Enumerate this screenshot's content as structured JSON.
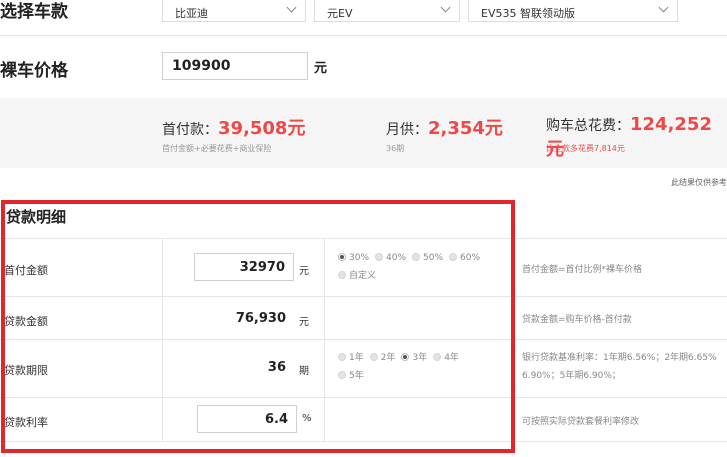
{
  "car_select": {
    "title": "选择车款",
    "brand": "比亚迪",
    "series": "元EV",
    "model": "EV535 智联领动版"
  },
  "price": {
    "title": "裸车价格",
    "value": "109900",
    "unit": "元"
  },
  "summary": {
    "down_label": "首付款：",
    "down_value": "39,508元",
    "down_sub": "首付金额+必要花费+商业保险",
    "monthly_label": "月供：",
    "monthly_value": "2,354元",
    "monthly_sub": "36期",
    "total_label": "购车总花费：",
    "total_value": "124,252元",
    "total_sub": "比全款多花费7,814元",
    "note": "此结果仅供参考"
  },
  "loan": {
    "title": "贷款明细",
    "rows": [
      {
        "label": "首付金额",
        "value": "32970",
        "unit": "元",
        "options": [
          "30%",
          "40%",
          "50%",
          "60%",
          "自定义"
        ],
        "note": "首付金额=首付比例*裸车价格"
      },
      {
        "label": "贷款金额",
        "value": "76,930",
        "unit": "元",
        "note": "贷款金额=购车价格-首付款"
      },
      {
        "label": "贷款期限",
        "value": "36",
        "unit": "期",
        "options": [
          "1年",
          "2年",
          "3年",
          "4年",
          "5年"
        ],
        "note": "银行贷款基准利率：1年期6.56%；2年期6.65%",
        "note2": "6.90%；5年期6.90%；"
      },
      {
        "label": "贷款利率",
        "value": "6.4",
        "unit": "%",
        "note": "可按照实际贷款套餐利率修改"
      }
    ]
  }
}
